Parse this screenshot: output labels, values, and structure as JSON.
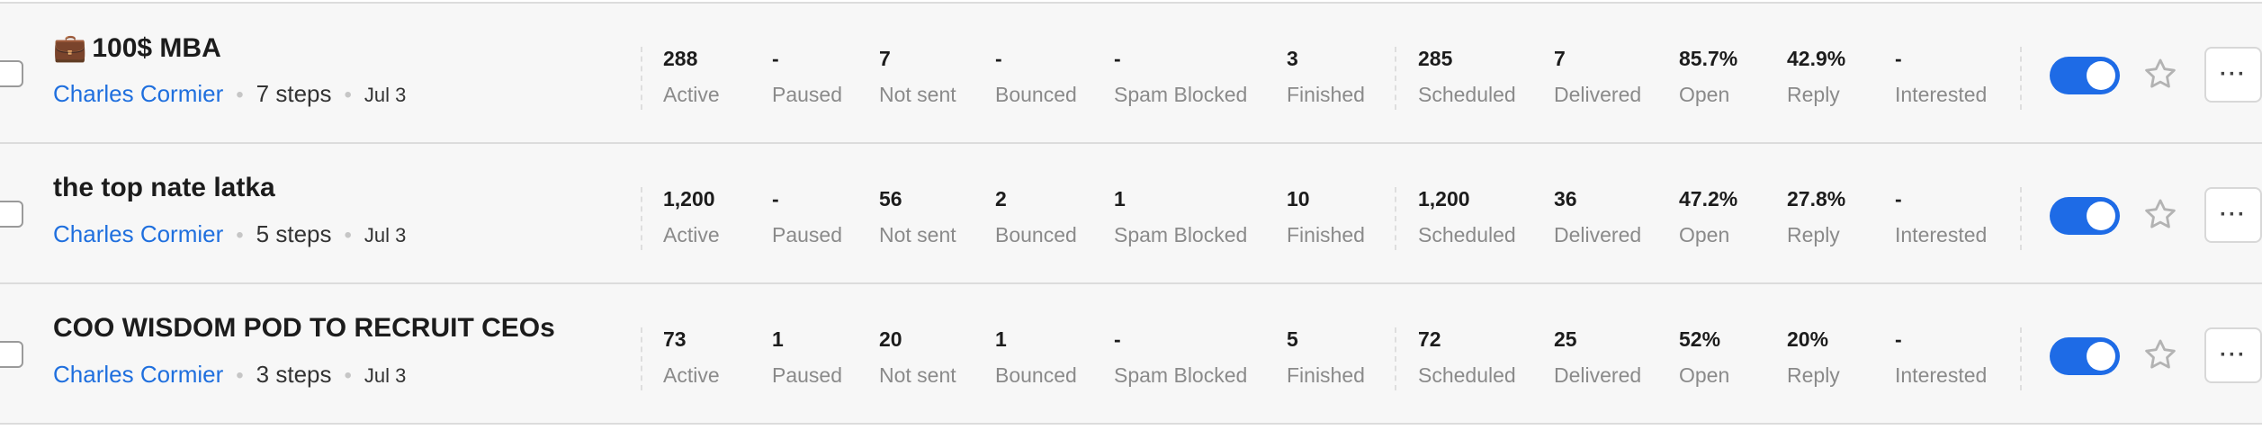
{
  "sequences": [
    {
      "emoji": "💼",
      "title": "100$ MBA",
      "owner": "Charles Cormier",
      "steps": "7 steps",
      "date": "Jul 3",
      "stats": [
        {
          "value": "288",
          "label": "Active"
        },
        {
          "value": "-",
          "label": "Paused"
        },
        {
          "value": "7",
          "label": "Not sent"
        },
        {
          "value": "-",
          "label": "Bounced"
        },
        {
          "value": "-",
          "label": "Spam Blocked"
        },
        {
          "value": "3",
          "label": "Finished"
        },
        {
          "value": "285",
          "label": "Scheduled"
        },
        {
          "value": "7",
          "label": "Delivered"
        },
        {
          "value": "85.7%",
          "label": "Open"
        },
        {
          "value": "42.9%",
          "label": "Reply"
        },
        {
          "value": "-",
          "label": "Interested"
        }
      ],
      "enabled": true
    },
    {
      "emoji": "",
      "title": "the top nate latka",
      "owner": "Charles Cormier",
      "steps": "5 steps",
      "date": "Jul 3",
      "stats": [
        {
          "value": "1,200",
          "label": "Active"
        },
        {
          "value": "-",
          "label": "Paused"
        },
        {
          "value": "56",
          "label": "Not sent"
        },
        {
          "value": "2",
          "label": "Bounced"
        },
        {
          "value": "1",
          "label": "Spam Blocked"
        },
        {
          "value": "10",
          "label": "Finished"
        },
        {
          "value": "1,200",
          "label": "Scheduled"
        },
        {
          "value": "36",
          "label": "Delivered"
        },
        {
          "value": "47.2%",
          "label": "Open"
        },
        {
          "value": "27.8%",
          "label": "Reply"
        },
        {
          "value": "-",
          "label": "Interested"
        }
      ],
      "enabled": true
    },
    {
      "emoji": "",
      "title": "COO WISDOM POD TO RECRUIT CEOs",
      "owner": "Charles Cormier",
      "steps": "3 steps",
      "date": "Jul 3",
      "stats": [
        {
          "value": "73",
          "label": "Active"
        },
        {
          "value": "1",
          "label": "Paused"
        },
        {
          "value": "20",
          "label": "Not sent"
        },
        {
          "value": "1",
          "label": "Bounced"
        },
        {
          "value": "-",
          "label": "Spam Blocked"
        },
        {
          "value": "5",
          "label": "Finished"
        },
        {
          "value": "72",
          "label": "Scheduled"
        },
        {
          "value": "25",
          "label": "Delivered"
        },
        {
          "value": "52%",
          "label": "Open"
        },
        {
          "value": "20%",
          "label": "Reply"
        },
        {
          "value": "-",
          "label": "Interested"
        }
      ],
      "enabled": true
    }
  ],
  "more_label": "···",
  "colors": {
    "accent": "#1e6be6",
    "link": "#1f6fde",
    "row_bg": "#f7f7f7"
  }
}
